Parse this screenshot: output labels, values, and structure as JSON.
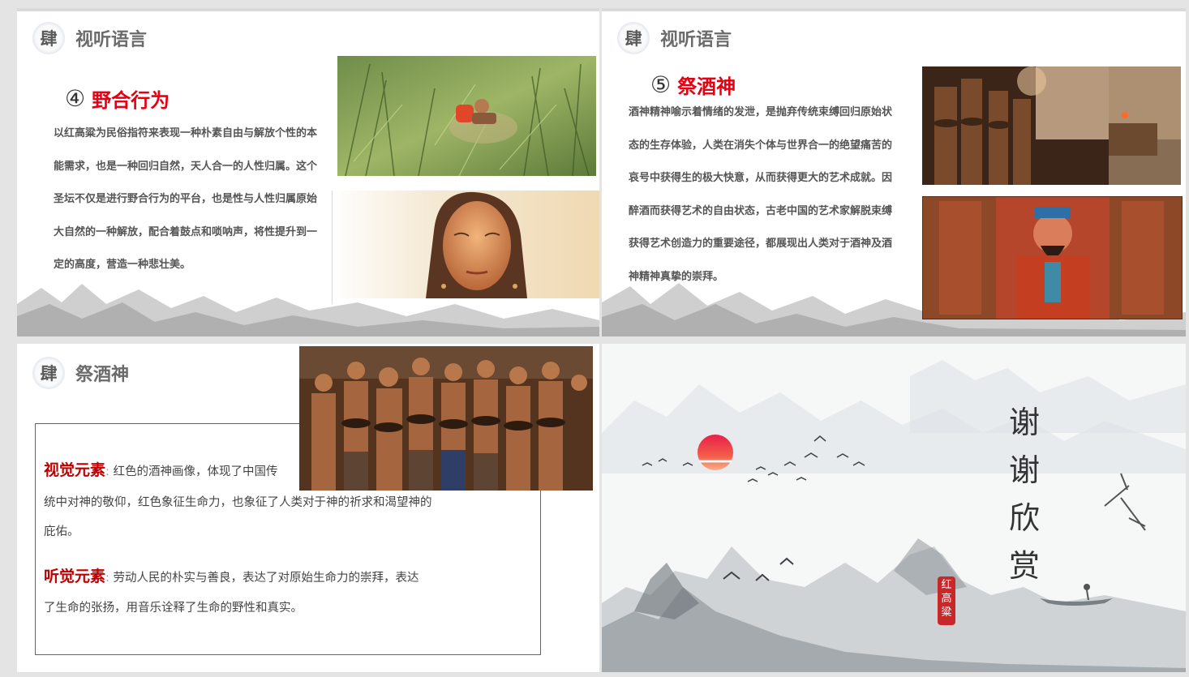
{
  "slide1": {
    "header": {
      "icon_char": "肆",
      "title": "视听语言"
    },
    "subtitle": {
      "number": "④",
      "text": "野合行为"
    },
    "lines": [
      "以红高粱为民俗指符来表现一种朴素自由与解放个性的本",
      "能需求，也是一种回归自然，天人合一的人性归属。这个",
      "圣坛不仅是进行野合行为的平台，也是性与人性归属原始",
      "大自然的一种解放，配合着鼓点和唢呐声，将性提升到一",
      "定的高度，营造一种悲壮美。"
    ]
  },
  "slide2": {
    "header": {
      "icon_char": "肆",
      "title": "视听语言"
    },
    "subtitle": {
      "number": "⑤",
      "text": "祭酒神"
    },
    "lines": [
      "酒神精神喻示着情绪的发泄，是抛弃传统束缚回归原始状",
      "态的生存体验，人类在消失个体与世界合一的绝望痛苦的",
      "哀号中获得生的极大快意，从而获得更大的艺术成就。因",
      "醉酒而获得艺术的自由状态，古老中国的艺术家解脱束缚",
      "获得艺术创造力的重要途径，都展现出人类对于酒神及酒",
      "神精神真挚的崇拜。"
    ]
  },
  "slide3": {
    "header": {
      "icon_char": "肆",
      "title": "祭酒神"
    },
    "visual": {
      "label": "视觉元素",
      "sep": ":",
      "line1": "红色的酒神画像，体现了中国传",
      "line2": "统中对神的敬仰，红色象征生命力，也象征了人类对于神的祈求和渴望神的",
      "line3": "庇佑。"
    },
    "audio": {
      "label": "听觉元素",
      "sep": ":",
      "line1": "劳动人民的朴实与善良，表达了对原始生命力的崇拜，表达",
      "line2": "了生命的张扬，用音乐诠释了生命的野性和真实。"
    }
  },
  "slide4": {
    "thanks": [
      "谢",
      "谢",
      "欣",
      "赏"
    ],
    "seal": [
      "红",
      "高",
      "粱"
    ]
  }
}
